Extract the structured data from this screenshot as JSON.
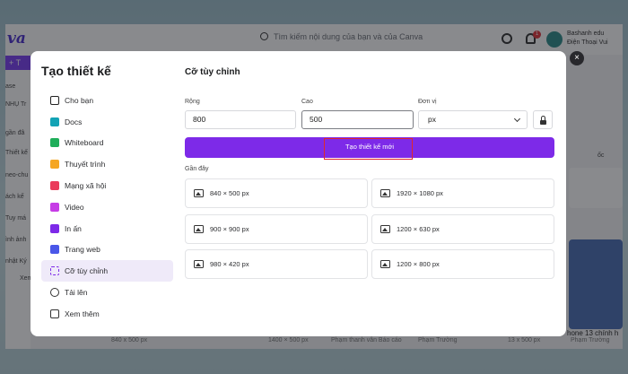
{
  "background_app": {
    "logo": "va",
    "search_placeholder": "Tìm kiếm nội dung của bạn và của Canva",
    "notification_count": "1",
    "user_name": "Bashanh edu",
    "user_sub": "Điện Thoại Vui",
    "sidebar_texts": [
      "ase",
      "NHỤ Tr",
      "gần đâ",
      "Thiết kế",
      "neo-chu",
      "ách kế",
      "Tuy má",
      "ình ảnh",
      "nhật Ký",
      "Xem"
    ],
    "bottom_strip": [
      "840 x 500 px",
      "1400 × 500 px",
      "Phạm thanh vân Báo cáo",
      "Phạm Trường",
      "13 x 500 px",
      "Phạm Trường"
    ],
    "right_preview_text": "hone 13 chính h",
    "right_label": "ốc"
  },
  "modal": {
    "title": "Tạo thiết kế",
    "nav": [
      {
        "label": "Cho bạn",
        "icon": "sparkle-icon",
        "color": "#222222"
      },
      {
        "label": "Docs",
        "icon": "docs-icon",
        "color": "#13a3b5"
      },
      {
        "label": "Whiteboard",
        "icon": "whiteboard-icon",
        "color": "#1fae5a"
      },
      {
        "label": "Thuyết trình",
        "icon": "presentation-icon",
        "color": "#f5a623"
      },
      {
        "label": "Mạng xã hội",
        "icon": "heart-icon",
        "color": "#ea3b5a"
      },
      {
        "label": "Video",
        "icon": "video-icon",
        "color": "#c63ce6"
      },
      {
        "label": "In ấn",
        "icon": "print-icon",
        "color": "#7d2ae8"
      },
      {
        "label": "Trang web",
        "icon": "website-icon",
        "color": "#4a57e8"
      },
      {
        "label": "Cỡ tùy chỉnh",
        "icon": "custom-size-icon",
        "color": "#7d2ae8"
      },
      {
        "label": "Tải lên",
        "icon": "upload-icon",
        "color": "#333333"
      },
      {
        "label": "Xem thêm",
        "icon": "more-icon",
        "color": "#333333"
      }
    ],
    "active_nav_index": 8,
    "section_title": "Cỡ tùy chỉnh",
    "width_label": "Rộng",
    "width_value": "800",
    "height_label": "Cao",
    "height_value": "500",
    "unit_label": "Đơn vị",
    "unit_value": "px",
    "create_button": "Tạo thiết kế mới",
    "recent_label": "Gần đây",
    "recent": [
      "840 × 500 px",
      "1920 × 1080 px",
      "900 × 900 px",
      "1200 × 630 px",
      "980 × 420 px",
      "1200 × 800 px"
    ],
    "close_symbol": "×",
    "brand_color": "#7d2ae8",
    "highlight_color": "#e0272c"
  }
}
